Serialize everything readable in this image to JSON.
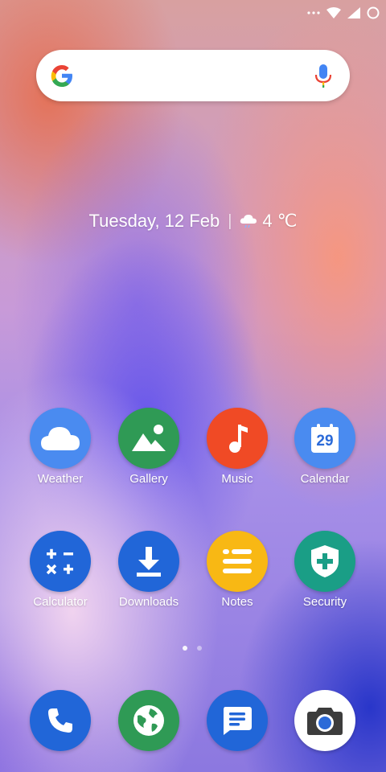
{
  "status_bar": {
    "icons": [
      "more-dots-icon",
      "wifi-icon",
      "signal-icon",
      "battery-ring-icon"
    ]
  },
  "search": {
    "left_icon": "google-g-icon",
    "right_icon": "microphone-icon"
  },
  "date_weather": {
    "date": "Tuesday, 12 Feb",
    "temperature": "4 ℃",
    "weather_icon": "cloud-rain-icon"
  },
  "apps": [
    {
      "label": "Weather",
      "icon": "cloud-icon",
      "color": "#4a8bf0"
    },
    {
      "label": "Gallery",
      "icon": "landscape-icon",
      "color": "#2f9a55"
    },
    {
      "label": "Music",
      "icon": "music-note-icon",
      "color": "#f04a25"
    },
    {
      "label": "Calendar",
      "icon": "calendar-icon",
      "color": "#4a8bf0",
      "date": "29"
    },
    {
      "label": "Calculator",
      "icon": "calculator-icon",
      "color": "#2166d8"
    },
    {
      "label": "Downloads",
      "icon": "download-icon",
      "color": "#2166d8"
    },
    {
      "label": "Notes",
      "icon": "notes-icon",
      "color": "#f8b814"
    },
    {
      "label": "Security",
      "icon": "shield-plus-icon",
      "color": "#1a9e86"
    }
  ],
  "page_indicator": {
    "pages": 2,
    "current": 1
  },
  "dock": [
    {
      "icon": "phone-icon",
      "color": "#2166d8"
    },
    {
      "icon": "globe-icon",
      "color": "#2f9a55"
    },
    {
      "icon": "message-icon",
      "color": "#2166d8"
    },
    {
      "icon": "camera-icon",
      "color": "#ffffff"
    }
  ]
}
